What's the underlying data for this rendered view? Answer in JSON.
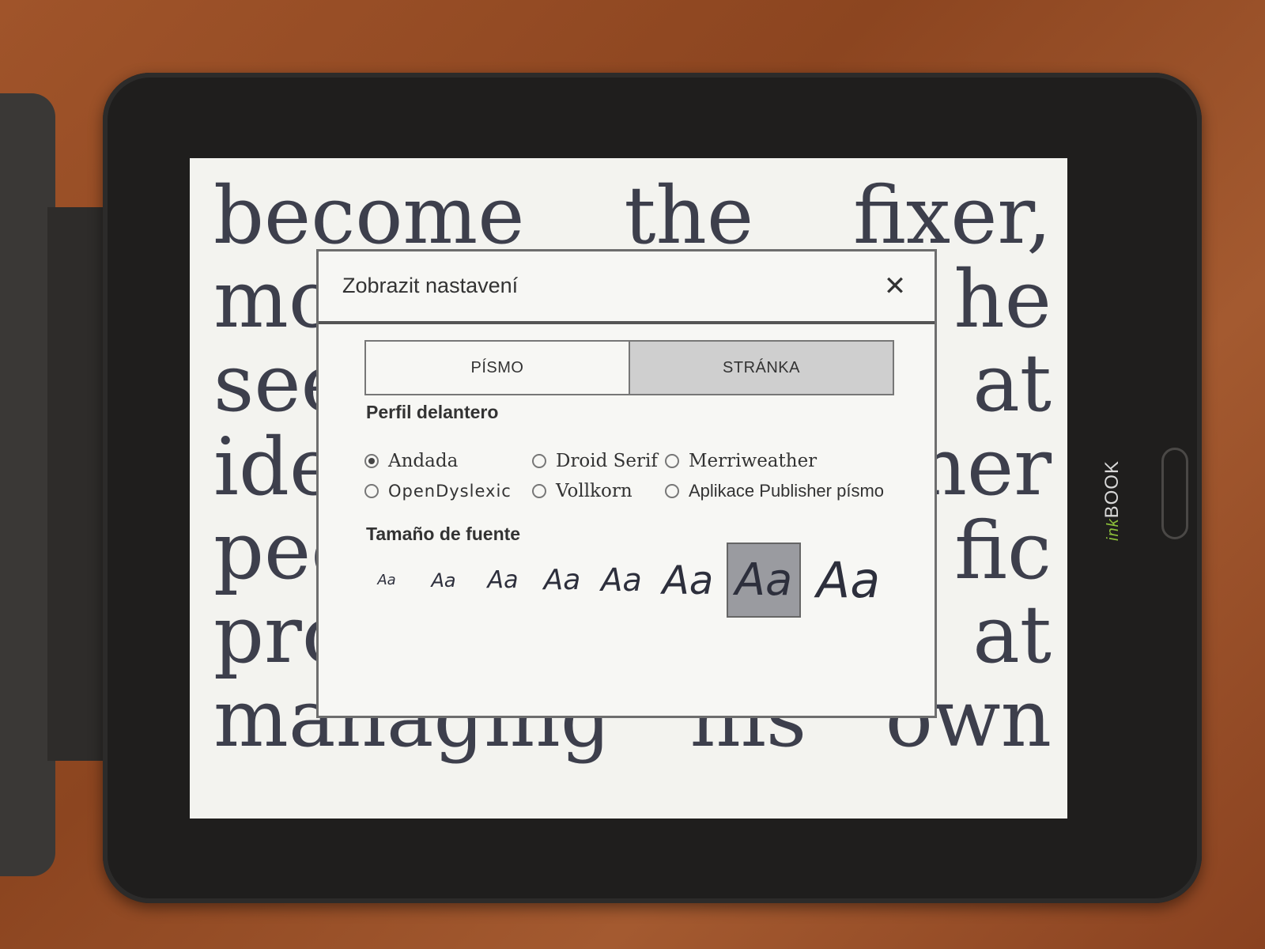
{
  "device": {
    "brand_prefix": "ink",
    "brand_name": "BOOK"
  },
  "book": {
    "lines": [
      [
        "become",
        "the",
        "fixer,"
      ],
      [
        "mo",
        "he"
      ],
      [
        "see",
        "at"
      ],
      [
        "ide",
        "her"
      ],
      [
        "pec",
        "fic"
      ],
      [
        "pro",
        "at"
      ],
      [
        "managing",
        "his",
        "own"
      ]
    ]
  },
  "dialog": {
    "title": "Zobrazit nastavení",
    "close_icon": "close-icon",
    "tabs": [
      {
        "label": "PÍSMO",
        "active": true
      },
      {
        "label": "STRÁNKA",
        "active": false
      }
    ],
    "font_section_title": "Perfil delantero",
    "fonts": [
      {
        "label": "Andada",
        "checked": true
      },
      {
        "label": "Droid Serif",
        "checked": false
      },
      {
        "label": "Merriweather",
        "checked": false
      },
      {
        "label": "OpenDyslexic",
        "checked": false
      },
      {
        "label": "Vollkorn",
        "checked": false
      },
      {
        "label": "Aplikace Publisher písmo",
        "checked": false
      }
    ],
    "size_section_title": "Tamaño de fuente",
    "sizes": [
      {
        "label": "Aa",
        "selected": false
      },
      {
        "label": "Aa",
        "selected": false
      },
      {
        "label": "Aa",
        "selected": false
      },
      {
        "label": "Aa",
        "selected": false
      },
      {
        "label": "Aa",
        "selected": false
      },
      {
        "label": "Aa",
        "selected": false
      },
      {
        "label": "Aa",
        "selected": true
      },
      {
        "label": "Aa",
        "selected": false
      }
    ]
  }
}
